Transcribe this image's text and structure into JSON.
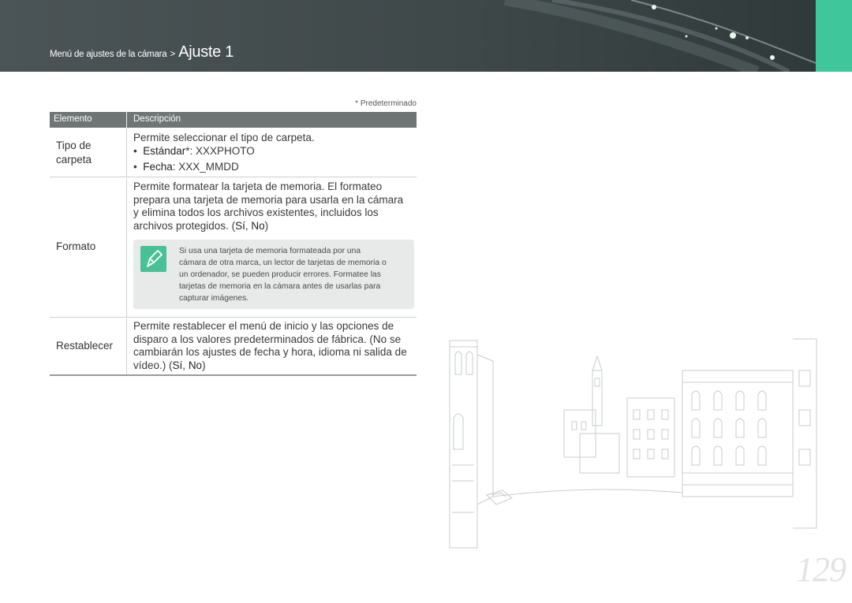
{
  "header": {
    "breadcrumb_parent": "Menú de ajustes de la cámara",
    "breadcrumb_separator": ">",
    "breadcrumb_current": "Ajuste 1",
    "accent_color": "#3fc79b"
  },
  "default_note": "* Predeterminado",
  "table": {
    "col_element": "Elemento",
    "col_description": "Descripción",
    "rows": [
      {
        "label_line1": "Tipo de",
        "label_line2": "carpeta",
        "intro": "Permite seleccionar el tipo de carpeta.",
        "bullet1_key": "Estándar",
        "bullet1_rest": "*: XXXPHOTO",
        "bullet2_key": "Fecha",
        "bullet2_rest": ": XXX_MMDD"
      },
      {
        "label": "Formato",
        "line1": "Permite formatear la tarjeta de memoria. El formateo",
        "line2": "prepara una tarjeta de memoria para usarla en la cámara",
        "line3": "y elimina todos los archivos existentes, incluidos los",
        "line4_pre": "archivos protegidos. (",
        "line4_yes": "Sí",
        "line4_sep": ", ",
        "line4_no": "No",
        "line4_post": ")",
        "note_lines": [
          "Si usa una tarjeta de memoria formateada por una",
          "cámara de otra marca, un lector de tarjetas de memoria o",
          "un ordenador, se pueden producir errores. Formatee las",
          "tarjetas de memoria en la cámara antes de usarlas para",
          "capturar imágenes."
        ],
        "note_icon": "pen-note-icon"
      },
      {
        "label": "Restablecer",
        "line1": "Permite restablecer el menú de inicio y las opciones de",
        "line2": "disparo a los valores predeterminados de fábrica. (No se",
        "line3": "cambiarán los ajustes de fecha y hora, idioma ni salida de",
        "line4_pre": "vídeo.) (",
        "line4_yes": "Sí",
        "line4_sep": ", ",
        "line4_no": "No",
        "line4_post": ")"
      }
    ]
  },
  "page_number": "129"
}
